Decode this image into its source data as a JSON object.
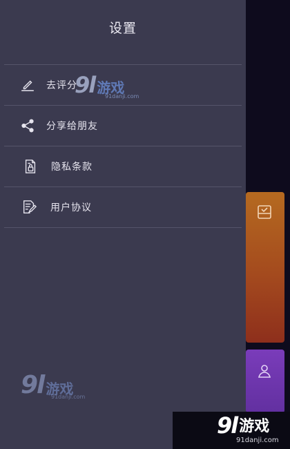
{
  "drawer": {
    "title": "设置",
    "items": [
      {
        "id": "rate",
        "label": "去评分",
        "icon": "pen-sign-icon"
      },
      {
        "id": "share",
        "label": "分享给朋友",
        "icon": "share-icon"
      },
      {
        "id": "privacy",
        "label": "隐私条款",
        "icon": "document-lock-icon"
      },
      {
        "id": "agreement",
        "label": "用户协议",
        "icon": "document-edit-icon"
      }
    ]
  },
  "background": {
    "card_icons": [
      "checkbox-icon",
      "user-icon"
    ]
  },
  "watermark": {
    "brand_num": "9l",
    "brand_text": "游戏",
    "url": "91danji.com"
  },
  "colors": {
    "drawer_bg": "#3b3a4f",
    "divider": "#55546a",
    "text": "#e6e4ee",
    "card_orange": "#b56a20",
    "card_purple": "#7a3cba"
  }
}
